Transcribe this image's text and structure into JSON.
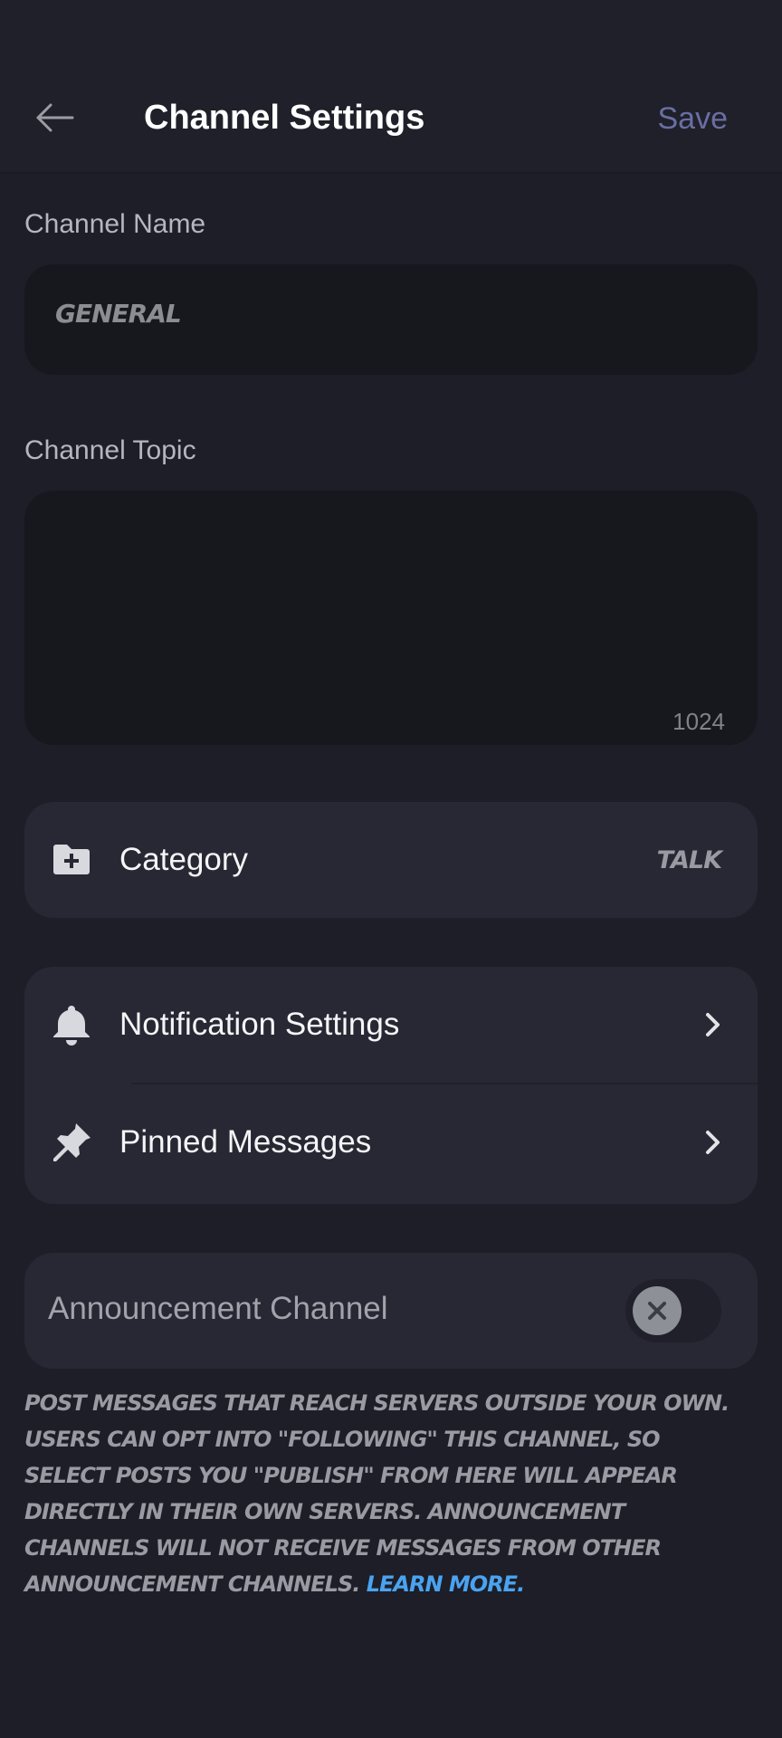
{
  "header": {
    "title": "Channel Settings",
    "save_label": "Save"
  },
  "channel_name": {
    "label": "Channel Name",
    "value": "general"
  },
  "channel_topic": {
    "label": "Channel Topic",
    "value": "",
    "char_remaining": "1024"
  },
  "category": {
    "icon": "folder-plus-icon",
    "label": "Category",
    "value": "talk"
  },
  "settings_list": {
    "notification_label": "Notification Settings",
    "notification_icon": "bell-icon",
    "pinned_label": "Pinned Messages",
    "pinned_icon": "pin-icon"
  },
  "announcement": {
    "label": "Announcement Channel",
    "enabled": false,
    "description": "Post messages that reach servers outside your own. Users can opt into \"following\" this channel, so select posts you \"publish\" from here will appear directly in their own servers. Announcement channels will not receive messages from other announcement channels. ",
    "learn_more": "Learn more."
  },
  "colors": {
    "background": "#1d1e28",
    "card": "#272833",
    "input": "#17181e",
    "accent_save": "#6a6ea4",
    "link": "#4aa3f0"
  }
}
